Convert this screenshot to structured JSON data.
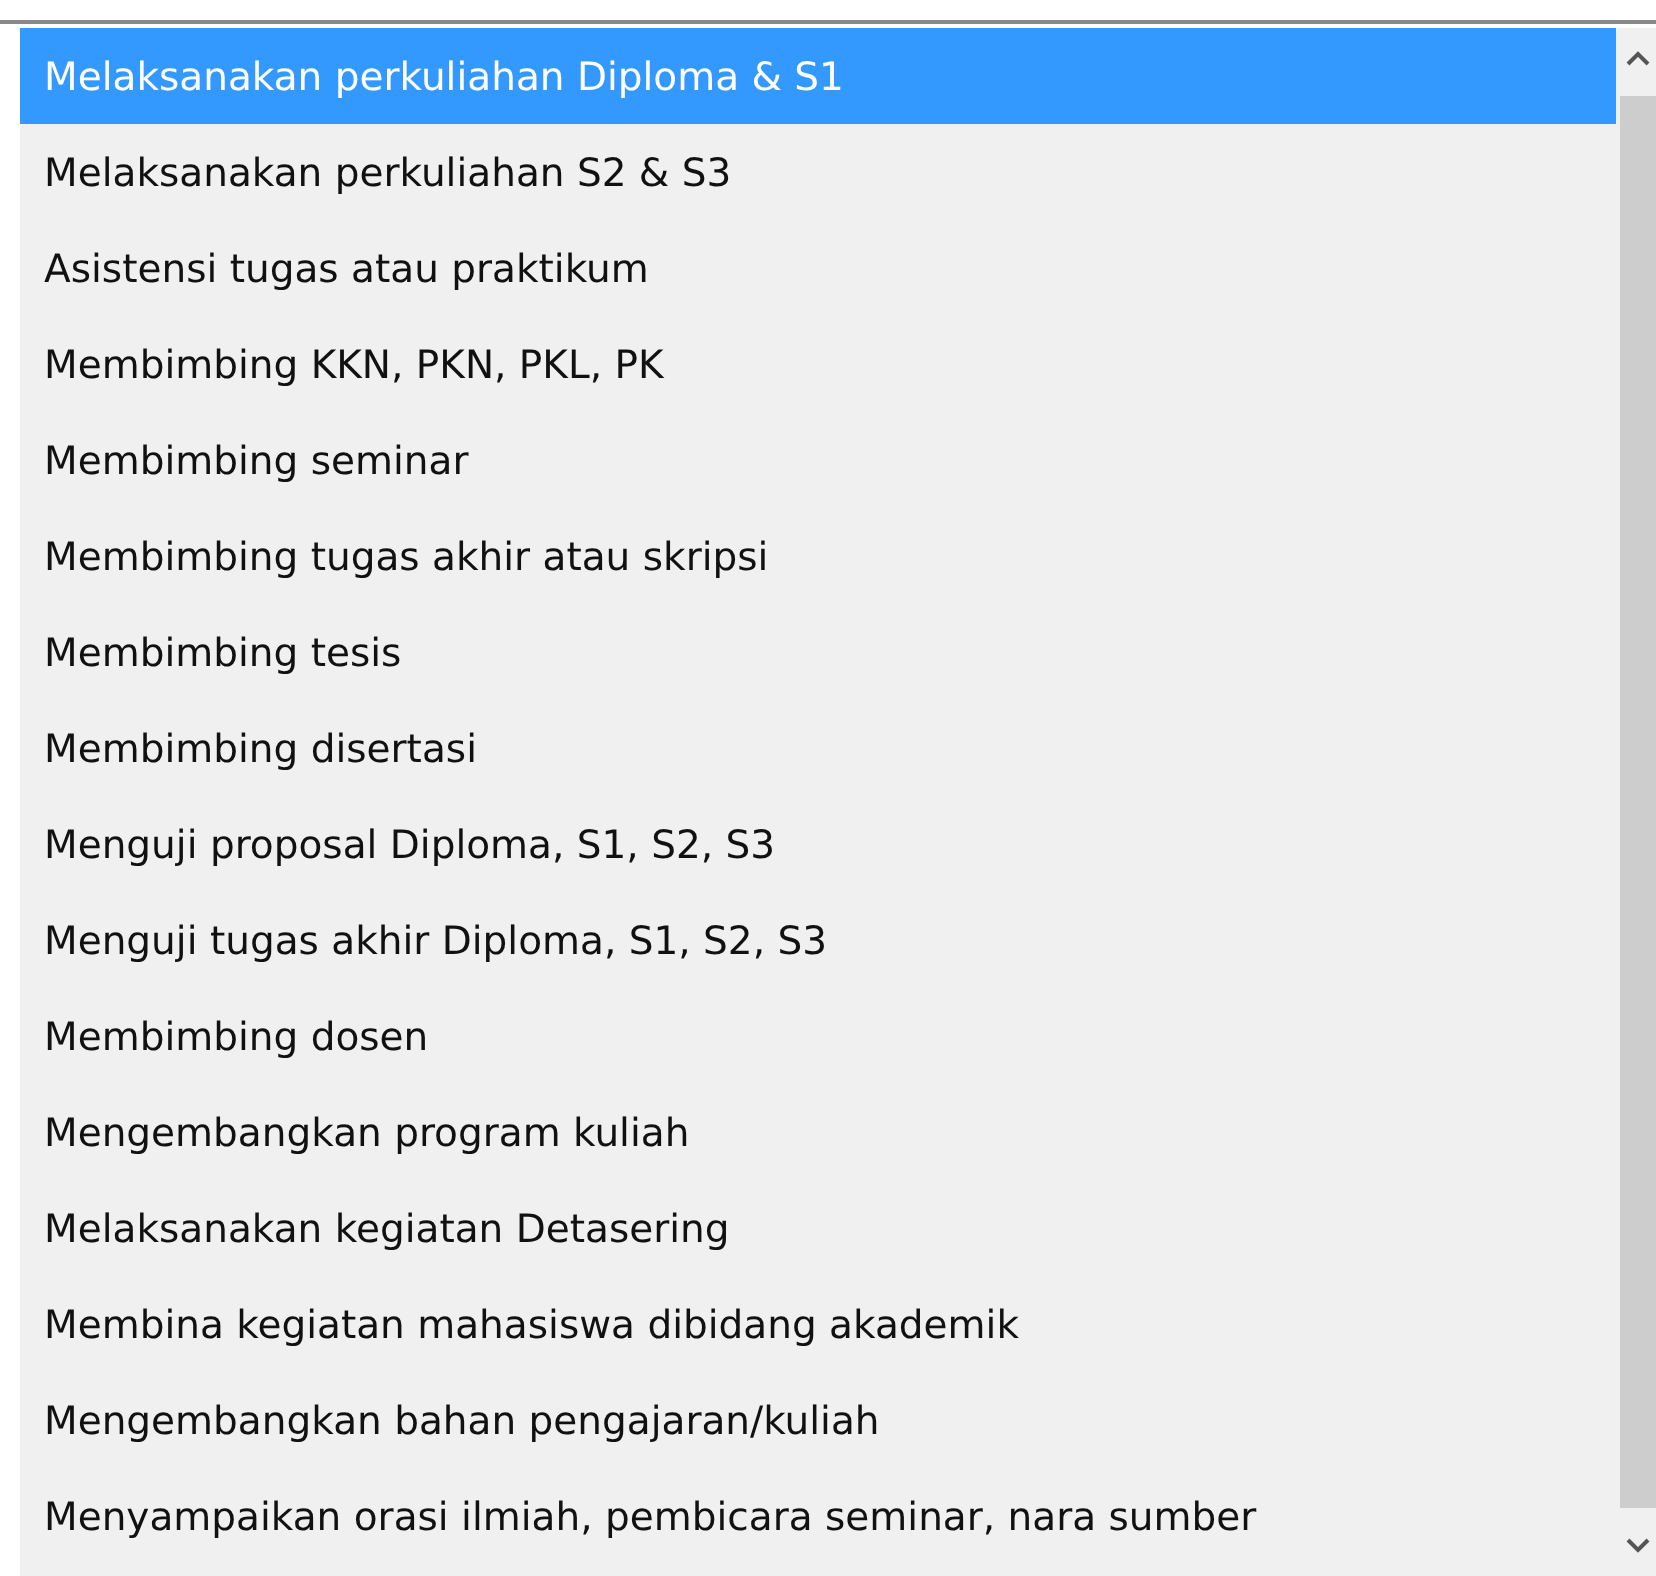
{
  "list": {
    "items": [
      {
        "label": "Melaksanakan perkuliahan Diploma & S1",
        "selected": true
      },
      {
        "label": "Melaksanakan perkuliahan S2 & S3",
        "selected": false
      },
      {
        "label": "Asistensi tugas atau praktikum",
        "selected": false
      },
      {
        "label": "Membimbing KKN, PKN, PKL, PK",
        "selected": false
      },
      {
        "label": "Membimbing seminar",
        "selected": false
      },
      {
        "label": "Membimbing tugas akhir atau skripsi",
        "selected": false
      },
      {
        "label": "Membimbing tesis",
        "selected": false
      },
      {
        "label": "Membimbing disertasi",
        "selected": false
      },
      {
        "label": "Menguji proposal Diploma, S1, S2, S3",
        "selected": false
      },
      {
        "label": "Menguji tugas akhir Diploma, S1, S2, S3",
        "selected": false
      },
      {
        "label": "Membimbing dosen",
        "selected": false
      },
      {
        "label": "Mengembangkan program kuliah",
        "selected": false
      },
      {
        "label": "Melaksanakan kegiatan Detasering",
        "selected": false
      },
      {
        "label": "Membina kegiatan mahasiswa dibidang akademik",
        "selected": false
      },
      {
        "label": "Mengembangkan bahan pengajaran/kuliah",
        "selected": false
      },
      {
        "label": "Menyampaikan orasi ilmiah, pembicara seminar, nara sumber",
        "selected": false
      }
    ]
  }
}
